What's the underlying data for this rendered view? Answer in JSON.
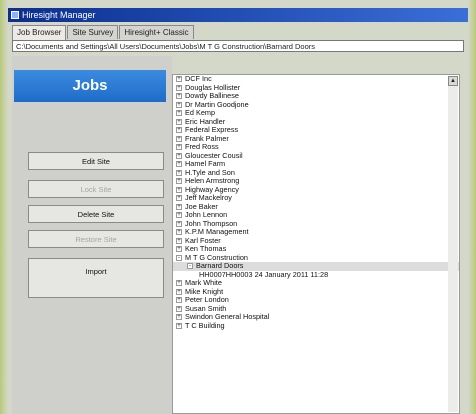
{
  "window": {
    "title": "Hiresight Manager"
  },
  "tabs": [
    {
      "label": "Job Browser"
    },
    {
      "label": "Site Survey"
    },
    {
      "label": "Hiresight+ Classic"
    }
  ],
  "path": "C:\\Documents and Settings\\All Users\\Documents\\Jobs\\M T G Construction\\Barnard Doors",
  "left_panel": {
    "header": "Jobs",
    "buttons": [
      {
        "label": "Edit Site",
        "enabled": true
      },
      {
        "label": "Lock Site",
        "enabled": false
      },
      {
        "label": "Delete Site",
        "enabled": true
      },
      {
        "label": "Restore Site",
        "enabled": false
      },
      {
        "label": "Import",
        "enabled": true
      }
    ]
  },
  "tree": {
    "items": [
      {
        "label": "DCF Inc",
        "level": 0,
        "expander": "+"
      },
      {
        "label": "Douglas Hollister",
        "level": 0,
        "expander": "+"
      },
      {
        "label": "Dowdy Ballinese",
        "level": 0,
        "expander": "+"
      },
      {
        "label": "Dr Martin Goodjone",
        "level": 0,
        "expander": "+"
      },
      {
        "label": "Ed Kemp",
        "level": 0,
        "expander": "+"
      },
      {
        "label": "Eric Handler",
        "level": 0,
        "expander": "+"
      },
      {
        "label": "Federal Express",
        "level": 0,
        "expander": "+"
      },
      {
        "label": "Frank Palmer",
        "level": 0,
        "expander": "+"
      },
      {
        "label": "Fred Ross",
        "level": 0,
        "expander": "+"
      },
      {
        "label": "Gloucester Cousil",
        "level": 0,
        "expander": "+"
      },
      {
        "label": "Hamel Farm",
        "level": 0,
        "expander": "+"
      },
      {
        "label": "H.Tyle and Son",
        "level": 0,
        "expander": "+"
      },
      {
        "label": "Helen Armstrong",
        "level": 0,
        "expander": "+"
      },
      {
        "label": "Highway Agency",
        "level": 0,
        "expander": "+"
      },
      {
        "label": "Jeff Mackelroy",
        "level": 0,
        "expander": "+"
      },
      {
        "label": "Joe Baker",
        "level": 0,
        "expander": "+"
      },
      {
        "label": "John Lennon",
        "level": 0,
        "expander": "+"
      },
      {
        "label": "John Thompson",
        "level": 0,
        "expander": "+"
      },
      {
        "label": "K.P.M Management",
        "level": 0,
        "expander": "+"
      },
      {
        "label": "Karl Foster",
        "level": 0,
        "expander": "+"
      },
      {
        "label": "Ken Thomas",
        "level": 0,
        "expander": "+"
      },
      {
        "label": "M T G Construction",
        "level": 0,
        "expander": "-"
      },
      {
        "label": "Barnard Doors",
        "level": 1,
        "expander": "-",
        "selected": true
      },
      {
        "label": "HH0007HH0003 24 January 2011 11:28",
        "level": 2,
        "expander": ""
      },
      {
        "label": "Mark White",
        "level": 0,
        "expander": "+"
      },
      {
        "label": "Mike Knight",
        "level": 0,
        "expander": "+"
      },
      {
        "label": "Peter London",
        "level": 0,
        "expander": "+"
      },
      {
        "label": "Susan Smith",
        "level": 0,
        "expander": "+"
      },
      {
        "label": "Swindon General Hospital",
        "level": 0,
        "expander": "+"
      },
      {
        "label": "T C Building",
        "level": 0,
        "expander": "+"
      }
    ]
  },
  "icons": {
    "app": "app-icon",
    "scroll_up": "scroll-up-arrow-icon"
  },
  "colors": {
    "title_bar": "#0b2e8f",
    "jobs_header": "#2a7ad6",
    "frame_border": "#b9c97a"
  }
}
